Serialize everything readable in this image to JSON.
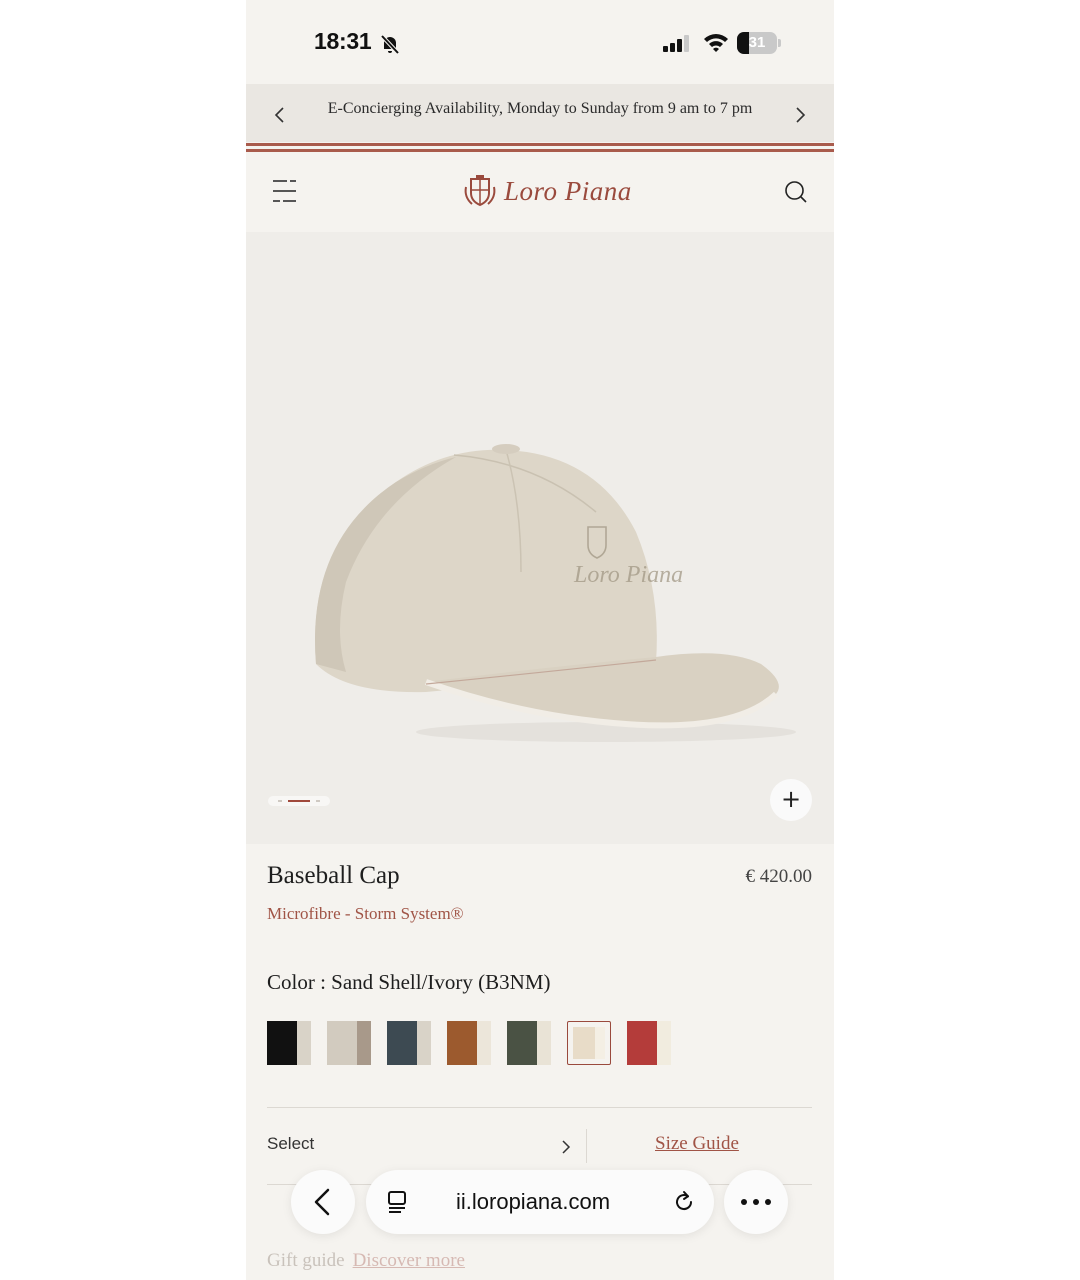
{
  "status_bar": {
    "time": "18:31",
    "battery": "31",
    "battery_level": 0.31,
    "icons": [
      "bell-slash-icon",
      "signal-icon",
      "wifi-icon",
      "battery-icon"
    ]
  },
  "announcement": {
    "text": "E-Concierging Availability, Monday to Sunday from 9 am to 7 pm",
    "prev_icon": "chevron-left-icon",
    "next_icon": "chevron-right-icon"
  },
  "header": {
    "menu_icon": "menu-icon",
    "logo_text": "Loro Piana",
    "search_icon": "search-icon"
  },
  "product": {
    "image_alt_icon": "baseball-cap-image",
    "zoom_label": "+",
    "title": "Baseball Cap",
    "price": "€ 420.00",
    "subtitle": "Microfibre - Storm System®",
    "color_label": "Color : Sand Shell/Ivory (B3NM)",
    "swatches": [
      {
        "a": "#111111",
        "b": "#d9d3c8",
        "selected": false
      },
      {
        "a": "#d2cbbf",
        "b": "#a8998a",
        "selected": false
      },
      {
        "a": "#3d4a52",
        "b": "#d9d3c8",
        "selected": false
      },
      {
        "a": "#9c5a2e",
        "b": "#ece6da",
        "selected": false
      },
      {
        "a": "#4a5244",
        "b": "#e9e3d6",
        "selected": false
      },
      {
        "a": "#e8dcc8",
        "b": "#f4efe4",
        "selected": true
      },
      {
        "a": "#b43c3a",
        "b": "#f1ecdf",
        "selected": false
      }
    ],
    "select_label": "Select",
    "size_guide": "Size Guide",
    "gift_label": "Gift guide",
    "gift_link": "Discover more"
  },
  "browser": {
    "url": "ii.loropiana.com",
    "back_icon": "back-arrow-icon",
    "tabs_icon": "tabs-icon",
    "reload_icon": "reload-icon",
    "more_icon": "more-icon"
  }
}
